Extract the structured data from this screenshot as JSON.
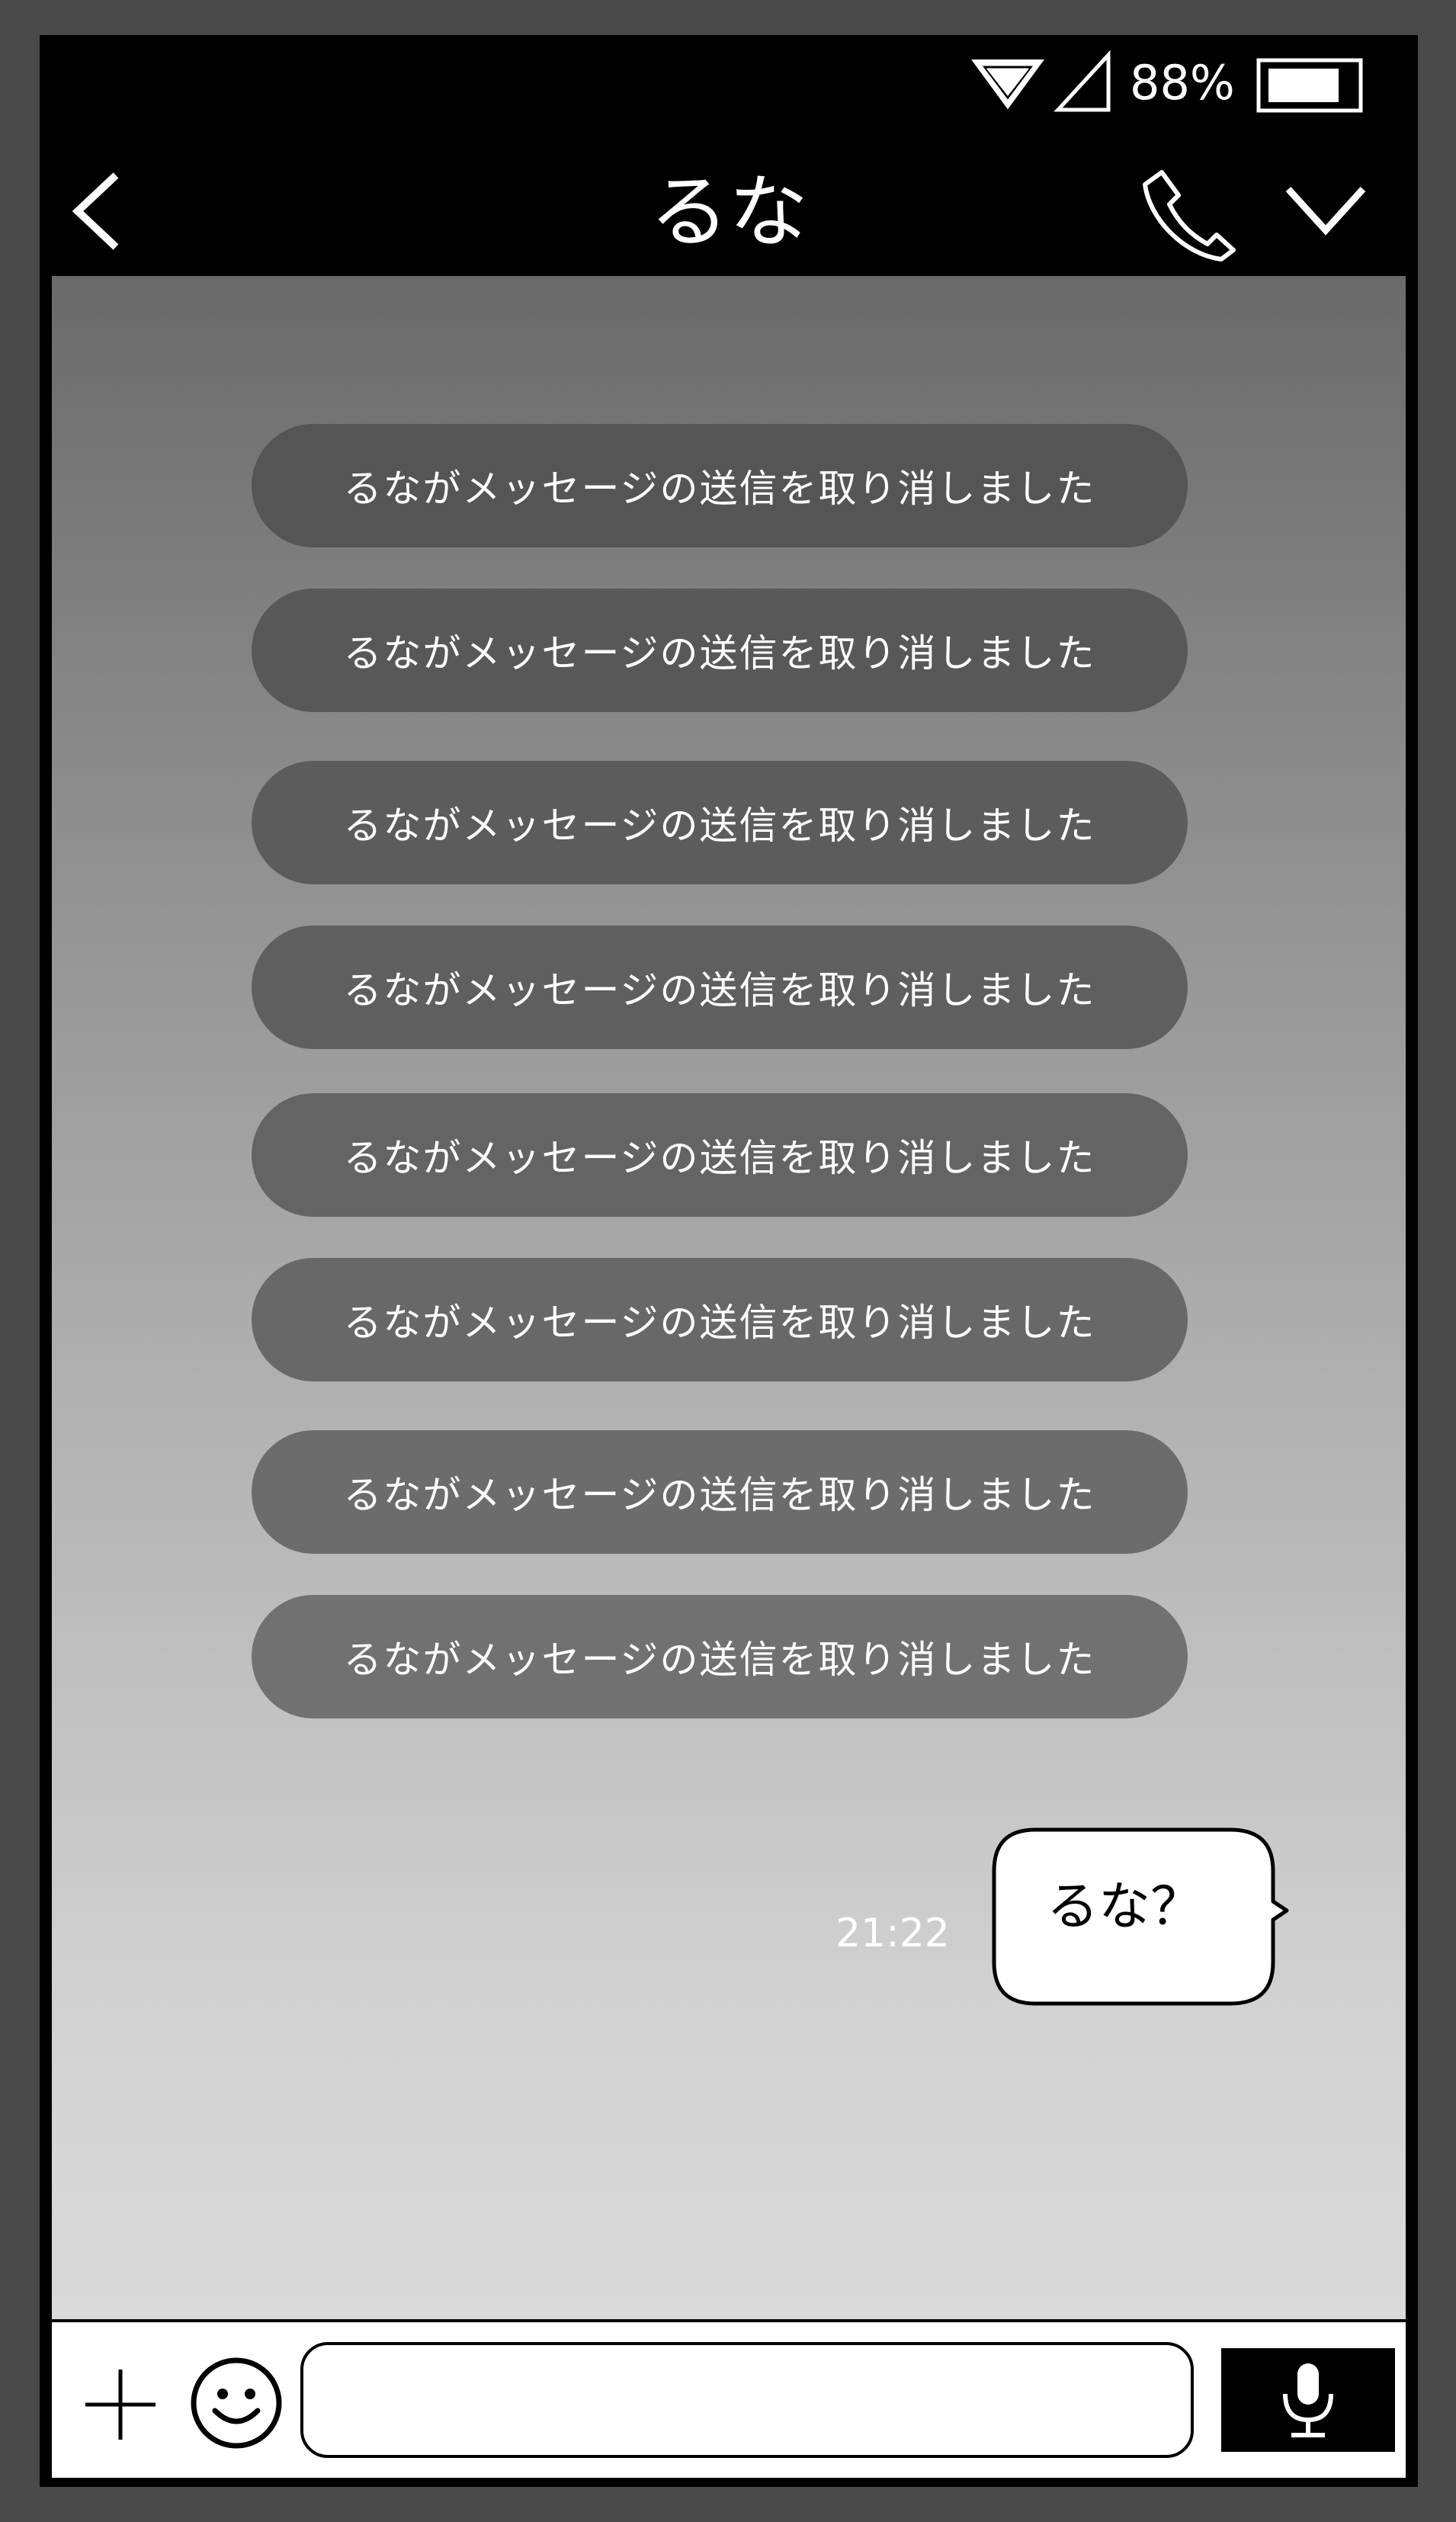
{
  "status_bar": {
    "battery_percent": "88%"
  },
  "header": {
    "contact_name": "るな"
  },
  "messages": {
    "unsent_notices": [
      "るながメッセージの送信を取り消しました",
      "るながメッセージの送信を取り消しました",
      "るながメッセージの送信を取り消しました",
      "るながメッセージの送信を取り消しました",
      "るながメッセージの送信を取り消しました",
      "るながメッセージの送信を取り消しました",
      "るながメッセージの送信を取り消しました",
      "るながメッセージの送信を取り消しました"
    ],
    "sent": {
      "text": "るな？",
      "time": "21:22"
    }
  },
  "input": {
    "value": "",
    "placeholder": ""
  },
  "colors": {
    "frame": "#4a4a4a",
    "header_bg": "#000000",
    "notice_pill": "#555555",
    "bubble_bg": "#ffffff"
  },
  "icons": [
    "wifi-icon",
    "signal-icon",
    "battery-icon",
    "back-chevron-icon",
    "phone-icon",
    "chevron-down-icon",
    "plus-icon",
    "emoji-icon",
    "microphone-icon"
  ]
}
